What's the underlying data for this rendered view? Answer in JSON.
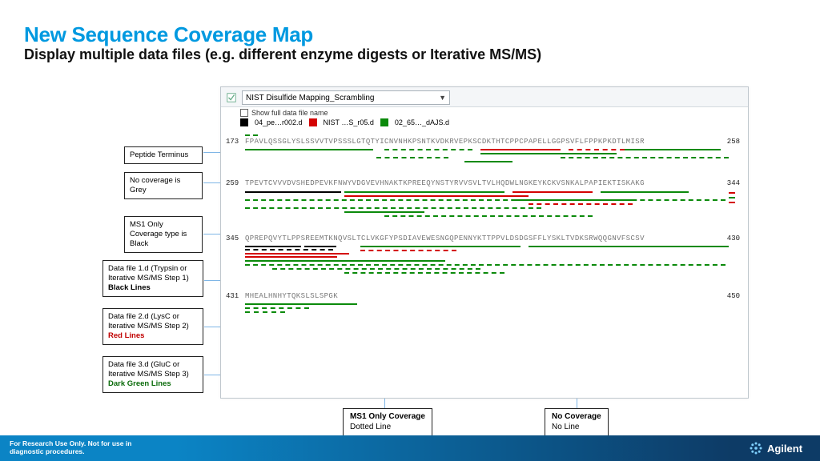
{
  "title": "New Sequence Coverage Map",
  "subtitle": "Display multiple data files (e.g. different enzyme digests or Iterative MS/MS)",
  "callouts": {
    "c1": "Peptide Terminus",
    "c2": " No coverage is Grey",
    "c3": "MS1 Only Coverage type is Black",
    "c4_a": "Data file 1.d (Trypsin or Iterative MS/MS Step 1)",
    "c4_b": "Black Lines",
    "c5_a": "Data file 2.d (LysC or Iterative MS/MS Step 2)",
    "c5_b": "Red Lines",
    "c6_a": "Data file 3.d (GluC or Iterative MS/MS Step 3)",
    "c6_b": "Dark Green Lines",
    "b1_a": "MS1 Only Coverage",
    "b1_b": "Dotted Line",
    "b2_a": "No Coverage",
    "b2_b": "No Line"
  },
  "panel": {
    "dropdown_value": "NIST Disulfide Mapping_Scrambling",
    "check_label": "Show full data file name",
    "legend": {
      "a": "04_pe…r002.d",
      "b": "NIST …S_r05.d",
      "c": "02_65…_dAJS.d"
    }
  },
  "rows": [
    {
      "start": "173",
      "end": "258",
      "seq": "FPAVLQSSGLYSLSSVVTVPSSSLGTQTYICNVNHKPSNTKVDKRVEPKSCDKTHTCPPCPAPELLGGPSVFLFPPKPKDTLMISR"
    },
    {
      "start": "259",
      "end": "344",
      "seq": "TPEVTCVVVDVSHEDPEVKFNWYVDGVEVHNAKTKPREEQYNSTYRVVSVLTVLHQDWLNGKEYKCKVSNKALPAPIEKTISKAKG"
    },
    {
      "start": "345",
      "end": "430",
      "seq": "QPREPQVYTLPPSREEMTKNQVSLTCLVKGFYPSDIAVEWESNGQPENNYKTTPPVLDSDGSFFLYSKLTVDKSRWQQGNVFSCSV"
    },
    {
      "start": "431",
      "end": "450",
      "seq": "MHEALHNHYTQKSLSLSPGK"
    }
  ],
  "footer": {
    "disclaimer": "For Research Use Only. Not for use in diagnostic procedures.",
    "brand": "Agilent"
  }
}
